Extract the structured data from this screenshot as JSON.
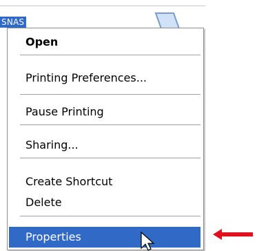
{
  "background": {
    "selected_item_label": "SNAS"
  },
  "context_menu": {
    "items": [
      {
        "label": "Open",
        "bold": true
      },
      {
        "label": "Printing Preferences..."
      },
      {
        "label": "Pause Printing"
      },
      {
        "label": "Sharing..."
      },
      {
        "label": "Create Shortcut"
      },
      {
        "label": "Delete"
      },
      {
        "label": "Properties",
        "highlighted": true
      }
    ]
  },
  "colors": {
    "highlight": "#3169c6",
    "annotation_arrow": "#e0101e"
  },
  "icons": {
    "background_item": "printer-folder-icon",
    "pointer": "mouse-pointer-icon",
    "annotation": "red-arrow-icon"
  }
}
